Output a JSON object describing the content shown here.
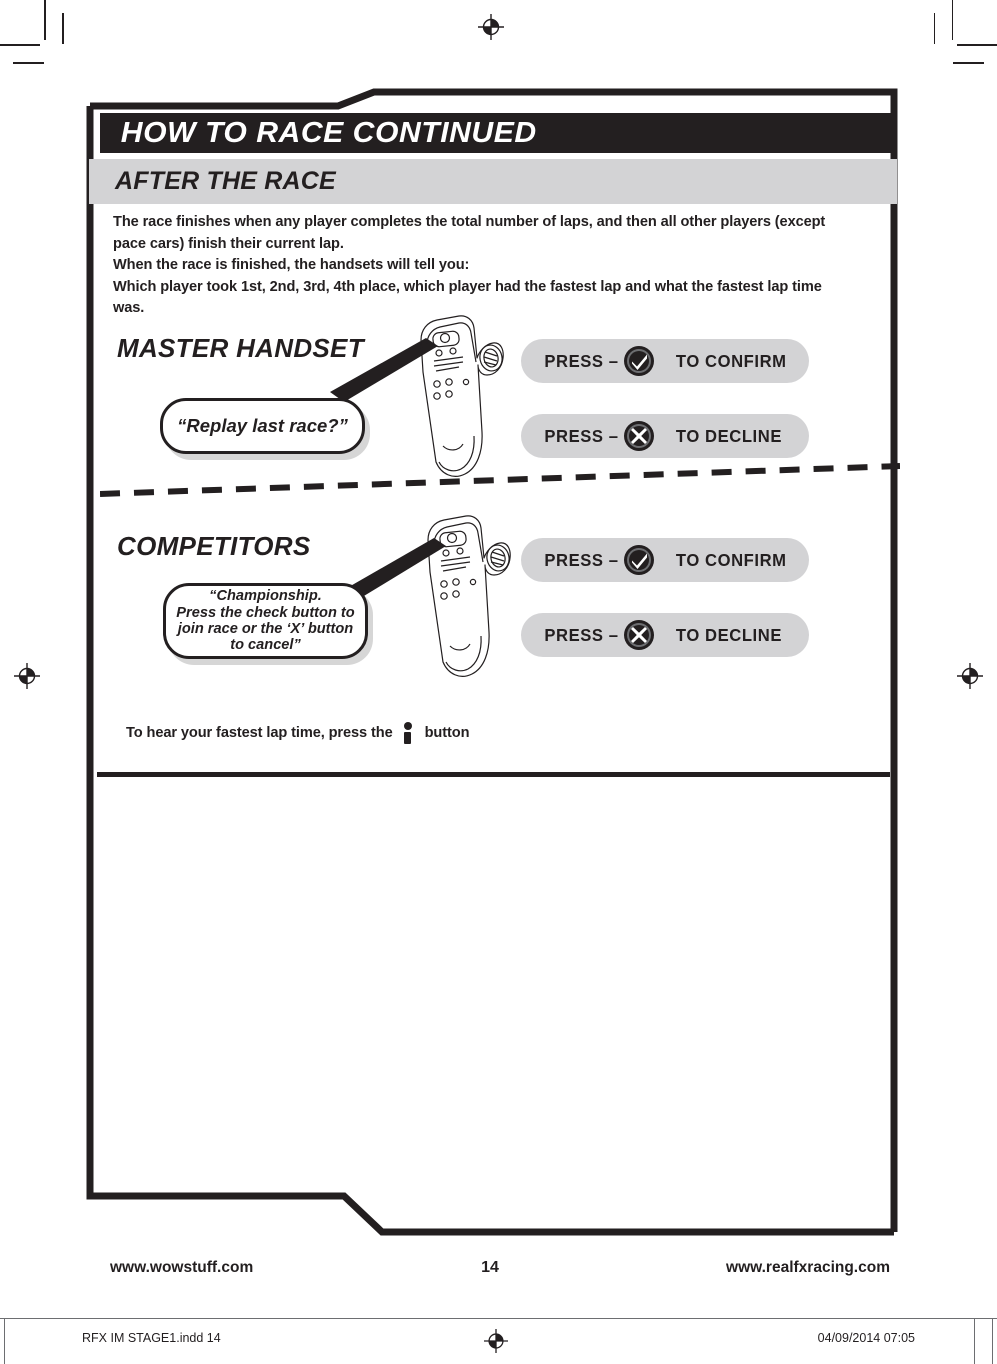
{
  "header": {
    "title": "HOW TO RACE CONTINUED"
  },
  "section": {
    "title": "AFTER THE RACE"
  },
  "intro": {
    "line1": "The race finishes when any player completes the total number of laps, and then all other players (except pace cars) finish their current lap.",
    "line2": "When the race is finished, the handsets will tell you:",
    "line3": "Which player took 1st, 2nd, 3rd, 4th place, which player had the fastest lap and what the fastest lap time was."
  },
  "master_section": {
    "heading": "MASTER HANDSET",
    "bubble_text": "“Replay last race?”",
    "confirm": {
      "pre": "PRESS –",
      "post": "TO CONFIRM",
      "icon": "check-circle-icon"
    },
    "decline": {
      "pre": "PRESS –",
      "post": "TO DECLINE",
      "icon": "x-circle-icon"
    }
  },
  "competitors_section": {
    "heading": "COMPETITORS",
    "bubble_line1": "“Championship.",
    "bubble_line2": "Press the check button to",
    "bubble_line3": "join race or the ‘X’ button",
    "bubble_line4": "to cancel”",
    "confirm": {
      "pre": "PRESS –",
      "post": "TO CONFIRM",
      "icon": "check-circle-icon"
    },
    "decline": {
      "pre": "PRESS –",
      "post": "TO DECLINE",
      "icon": "x-circle-icon"
    }
  },
  "bottom_note": {
    "before": "To hear your fastest lap time, press the",
    "icon": "info-button-icon",
    "after": "button"
  },
  "footer": {
    "left_url": "www.wowstuff.com",
    "page_number": "14",
    "right_url": "www.realfxracing.com"
  },
  "slug": {
    "left": "RFX IM STAGE1.indd   14",
    "right": "04/09/2014   07:05",
    "reg_icon": "registration-target-icon"
  },
  "colors": {
    "ink": "#231f20",
    "band": "#d3d3d5",
    "paper": "#ffffff"
  }
}
